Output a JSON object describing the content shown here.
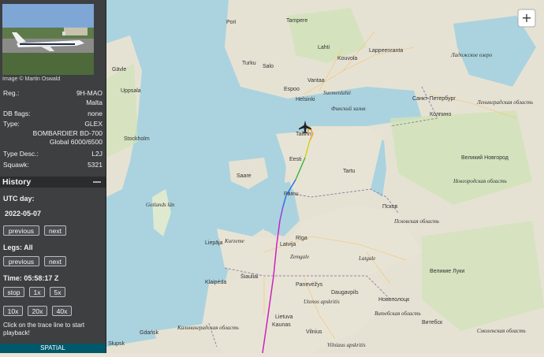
{
  "aircraft": {
    "photo_credit": "Image © Martin Oswald",
    "reg_label": "Reg.:",
    "reg": "9H-MAO",
    "country": "Malta",
    "db_flags_label": "DB flags:",
    "db_flags": "none",
    "type_label": "Type:",
    "type": "GLEX",
    "model": "BOMBARDIER BD-700 Global 6000/6500",
    "type_desc_label": "Type Desc.:",
    "type_desc": "L2J",
    "squawk_label": "Squawk:",
    "squawk": "5321"
  },
  "history": {
    "title": "History",
    "utc_day_label": "UTC day:",
    "date": "2022-05-07",
    "previous_label": "previous",
    "next_label": "next",
    "legs_label": "Legs: All",
    "time_label": "Time: 05:58:17 Z",
    "speed_buttons": [
      "stop",
      "1x",
      "5x",
      "10x",
      "20x",
      "40x"
    ],
    "hint": "Click on the trace line to start playback!"
  },
  "footer": {
    "spatial_label": "SPATIAL"
  },
  "map": {
    "places": {
      "pori": "Pori",
      "tampere": "Tampere",
      "lahti": "Lahti",
      "kouvola": "Kouvola",
      "lappeenranta": "Lappeenranta",
      "turku": "Turku",
      "salo": "Salo",
      "vantaa": "Vantaa",
      "espoo": "Espoo",
      "helsinki": "Helsinki",
      "spb": "Санкт-Петербург",
      "kolpino": "Колпино",
      "ladoga": "Ладожское озеро",
      "leningrad": "Ленинградская область",
      "suomenlahti": "Suomenlahti",
      "finnish_gulf": "Финский залив",
      "gavle": "Gävle",
      "uppsala": "Uppsala",
      "stockholm": "Stockholm",
      "tallinn": "Tallinn",
      "eesti": "Eesti",
      "tartu": "Tartu",
      "parnu": "Pärnu",
      "riga": "Rīga",
      "latvija": "Latvija",
      "liepaja": "Liepāja",
      "daugavpils": "Daugavpils",
      "lietuva": "Lietuva",
      "kaunas": "Kaunas",
      "vilnius": "Vilnius",
      "klaipeda": "Klaipėda",
      "siauliai": "Šiauliai",
      "panevezys": "Panevėžys",
      "gotland": "Gotlands län",
      "kaliningrad": "Калининградская область",
      "slupsk": "Słupsk",
      "gdansk": "Gdańsk",
      "pskov": "Псков",
      "pskov_obl": "Псковская область",
      "novgorod_obl": "Новгородская область",
      "vnovgorod": "Великий Новгород",
      "vluki": "Великие Луки",
      "novopolotsk": "Новополоцк",
      "vitebsk": "Витебск",
      "vitebsk_obl": "Витебская область",
      "smolensk_obl": "Смоленская область",
      "kurzeme": "Kurzeme",
      "zemgale": "Zemgale",
      "latgale": "Latgale",
      "utena": "Utenos apskritis",
      "vilniaus": "Vilniaus apskritis",
      "saaremaa": "Saare"
    }
  }
}
